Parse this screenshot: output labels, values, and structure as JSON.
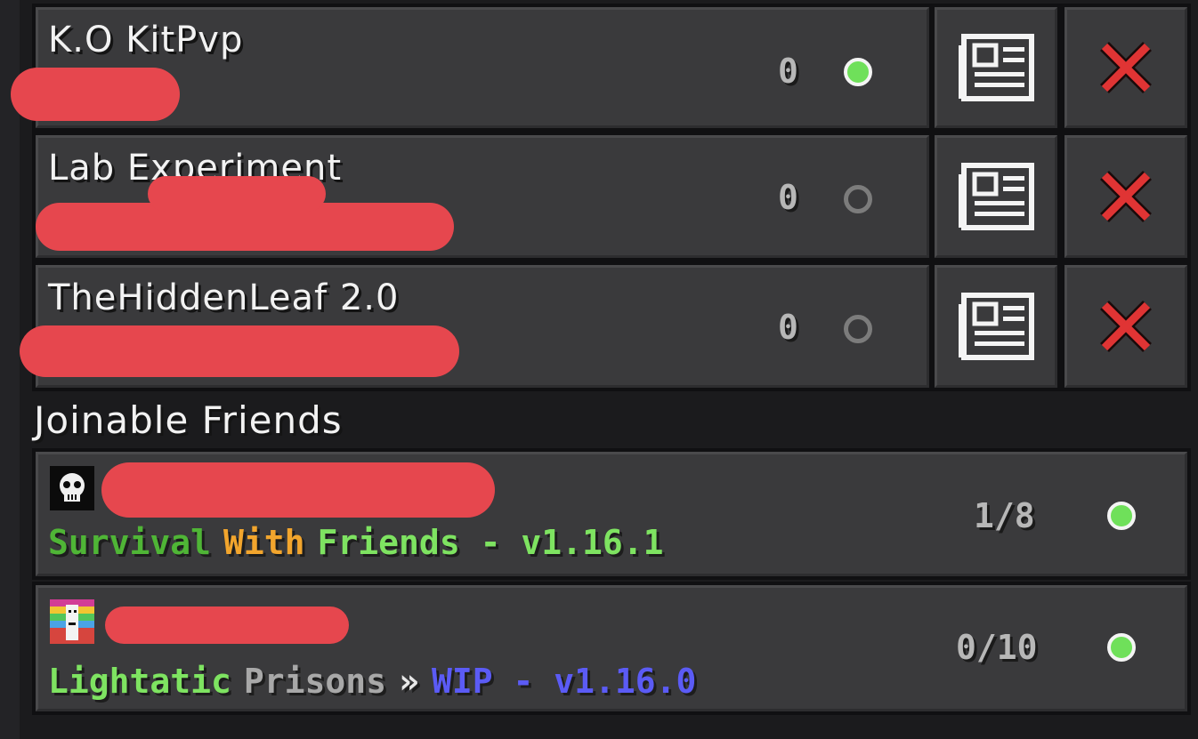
{
  "servers": [
    {
      "name": "K.O KitPvp",
      "players": "0",
      "online": true
    },
    {
      "name": "Lab Experiment",
      "players": "0",
      "online": false
    },
    {
      "name": "TheHiddenLeaf 2.0",
      "players": "0",
      "online": false
    }
  ],
  "section_title": "Joinable Friends",
  "friends": [
    {
      "players": "1/8",
      "online": true,
      "motd": [
        {
          "text": "Survival",
          "color": "#4fb536"
        },
        {
          "text": "With",
          "color": "#f2a52d"
        },
        {
          "text": "Friends - v1.16.1",
          "color": "#7ee361"
        }
      ]
    },
    {
      "players": "0/10",
      "online": true,
      "motd": [
        {
          "text": "Lightatic",
          "color": "#7ee361"
        },
        {
          "text": "Prisons",
          "color": "#a8a8a8"
        },
        {
          "text": "»",
          "color": "#e8e8e8"
        },
        {
          "text": "WIP - v1.16.0",
          "color": "#5b5bf5"
        }
      ]
    }
  ],
  "icons": {
    "edit": "newspaper-icon",
    "remove": "red-x-icon"
  }
}
